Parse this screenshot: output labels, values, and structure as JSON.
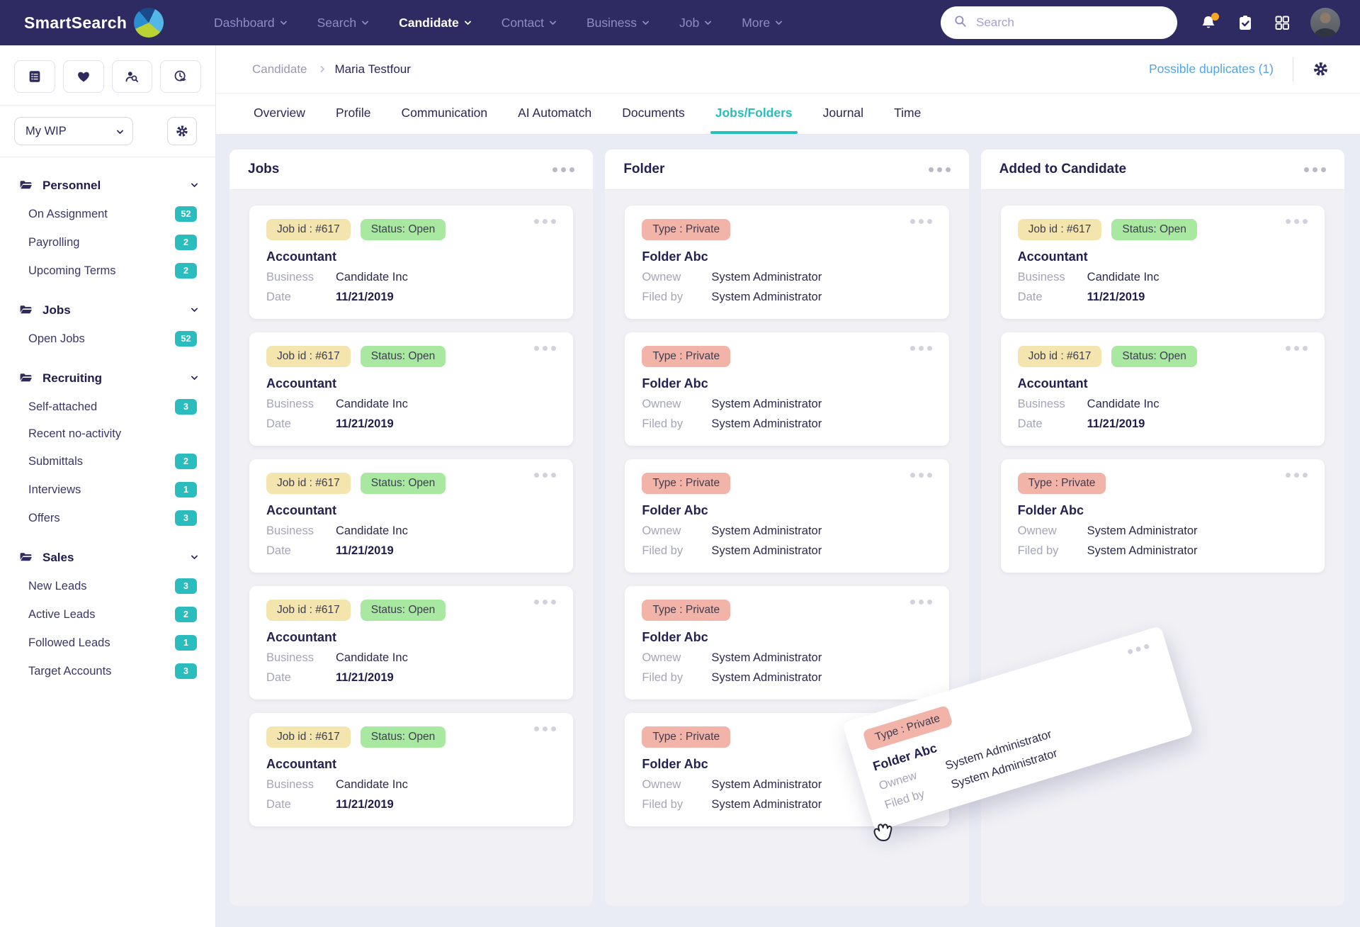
{
  "colors": {
    "navbar_bg": "#2e2a62",
    "accent_teal": "#2bbcbe",
    "link_blue": "#55a3e9",
    "badge_yellow": "#f3e5ad",
    "badge_green": "#a9e8a1",
    "badge_pink": "#f2b3a9",
    "notification_dot": "#f5a623"
  },
  "navbar": {
    "brand": "SmartSearch",
    "items": [
      {
        "label": "Dashboard"
      },
      {
        "label": "Search"
      },
      {
        "label": "Candidate",
        "active": true
      },
      {
        "label": "Contact"
      },
      {
        "label": "Business"
      },
      {
        "label": "Job"
      },
      {
        "label": "More"
      }
    ],
    "search_placeholder": "Search"
  },
  "sidebar": {
    "wip_selector": "My WIP",
    "sections": [
      {
        "label": "Personnel",
        "items": [
          {
            "label": "On Assignment",
            "count": "52"
          },
          {
            "label": "Payrolling",
            "count": "2"
          },
          {
            "label": "Upcoming Terms",
            "count": "2"
          }
        ]
      },
      {
        "label": "Jobs",
        "items": [
          {
            "label": "Open Jobs",
            "count": "52"
          }
        ]
      },
      {
        "label": "Recruiting",
        "items": [
          {
            "label": "Self-attached",
            "count": "3"
          },
          {
            "label": "Recent no-activity",
            "count": ""
          },
          {
            "label": "Submittals",
            "count": "2"
          },
          {
            "label": "Interviews",
            "count": "1"
          },
          {
            "label": "Offers",
            "count": "3"
          }
        ]
      },
      {
        "label": "Sales",
        "items": [
          {
            "label": "New Leads",
            "count": "3"
          },
          {
            "label": "Active Leads",
            "count": "2"
          },
          {
            "label": "Followed Leads",
            "count": "1"
          },
          {
            "label": "Target Accounts",
            "count": "3"
          }
        ]
      }
    ]
  },
  "header": {
    "breadcrumb_root": "Candidate",
    "breadcrumb_current": "Maria Testfour",
    "duplicates_link": "Possible duplicates (1)"
  },
  "tabs": [
    {
      "label": "Overview"
    },
    {
      "label": "Profile"
    },
    {
      "label": "Communication"
    },
    {
      "label": "AI Automatch"
    },
    {
      "label": "Documents"
    },
    {
      "label": "Jobs/Folders",
      "active": true
    },
    {
      "label": "Journal"
    },
    {
      "label": "Time"
    }
  ],
  "board": {
    "columns": [
      {
        "title": "Jobs",
        "cards": [
          {
            "badges": [
              {
                "text": "Job id : #617",
                "color": "yellow"
              },
              {
                "text": "Status: Open",
                "color": "green"
              }
            ],
            "title": "Accountant",
            "rows": [
              {
                "label": "Business",
                "value": "Candidate Inc"
              },
              {
                "label": "Date",
                "value": "11/21/2019",
                "strong": true
              }
            ]
          },
          {
            "badges": [
              {
                "text": "Job id : #617",
                "color": "yellow"
              },
              {
                "text": "Status: Open",
                "color": "green"
              }
            ],
            "title": "Accountant",
            "rows": [
              {
                "label": "Business",
                "value": "Candidate Inc"
              },
              {
                "label": "Date",
                "value": "11/21/2019",
                "strong": true
              }
            ]
          },
          {
            "badges": [
              {
                "text": "Job id : #617",
                "color": "yellow"
              },
              {
                "text": "Status: Open",
                "color": "green"
              }
            ],
            "title": "Accountant",
            "rows": [
              {
                "label": "Business",
                "value": "Candidate Inc"
              },
              {
                "label": "Date",
                "value": "11/21/2019",
                "strong": true
              }
            ]
          },
          {
            "badges": [
              {
                "text": "Job id : #617",
                "color": "yellow"
              },
              {
                "text": "Status: Open",
                "color": "green"
              }
            ],
            "title": "Accountant",
            "rows": [
              {
                "label": "Business",
                "value": "Candidate Inc"
              },
              {
                "label": "Date",
                "value": "11/21/2019",
                "strong": true
              }
            ]
          },
          {
            "badges": [
              {
                "text": "Job id : #617",
                "color": "yellow"
              },
              {
                "text": "Status: Open",
                "color": "green"
              }
            ],
            "title": "Accountant",
            "rows": [
              {
                "label": "Business",
                "value": "Candidate Inc"
              },
              {
                "label": "Date",
                "value": "11/21/2019",
                "strong": true
              }
            ]
          }
        ]
      },
      {
        "title": "Folder",
        "cards": [
          {
            "badges": [
              {
                "text": "Type : Private",
                "color": "pink"
              }
            ],
            "title": "Folder Abc",
            "rows": [
              {
                "label": "Ownew",
                "value": "System Administrator"
              },
              {
                "label": "Filed by",
                "value": "System Administrator"
              }
            ]
          },
          {
            "badges": [
              {
                "text": "Type : Private",
                "color": "pink"
              }
            ],
            "title": "Folder Abc",
            "rows": [
              {
                "label": "Ownew",
                "value": "System Administrator"
              },
              {
                "label": "Filed by",
                "value": "System Administrator"
              }
            ]
          },
          {
            "badges": [
              {
                "text": "Type : Private",
                "color": "pink"
              }
            ],
            "title": "Folder Abc",
            "rows": [
              {
                "label": "Ownew",
                "value": "System Administrator"
              },
              {
                "label": "Filed by",
                "value": "System Administrator"
              }
            ]
          },
          {
            "badges": [
              {
                "text": "Type : Private",
                "color": "pink"
              }
            ],
            "title": "Folder Abc",
            "rows": [
              {
                "label": "Ownew",
                "value": "System Administrator"
              },
              {
                "label": "Filed by",
                "value": "System Administrator"
              }
            ]
          },
          {
            "badges": [
              {
                "text": "Type : Private",
                "color": "pink"
              }
            ],
            "title": "Folder Abc",
            "rows": [
              {
                "label": "Ownew",
                "value": "System Administrator"
              },
              {
                "label": "Filed by",
                "value": "System Administrator"
              }
            ]
          }
        ]
      },
      {
        "title": "Added to Candidate",
        "cards": [
          {
            "badges": [
              {
                "text": "Job id : #617",
                "color": "yellow"
              },
              {
                "text": "Status: Open",
                "color": "green"
              }
            ],
            "title": "Accountant",
            "rows": [
              {
                "label": "Business",
                "value": "Candidate Inc"
              },
              {
                "label": "Date",
                "value": "11/21/2019",
                "strong": true
              }
            ]
          },
          {
            "badges": [
              {
                "text": "Job id : #617",
                "color": "yellow"
              },
              {
                "text": "Status: Open",
                "color": "green"
              }
            ],
            "title": "Accountant",
            "rows": [
              {
                "label": "Business",
                "value": "Candidate Inc"
              },
              {
                "label": "Date",
                "value": "11/21/2019",
                "strong": true
              }
            ]
          },
          {
            "badges": [
              {
                "text": "Type : Private",
                "color": "pink"
              }
            ],
            "title": "Folder Abc",
            "rows": [
              {
                "label": "Ownew",
                "value": "System Administrator"
              },
              {
                "label": "Filed by",
                "value": "System Administrator"
              }
            ]
          }
        ]
      }
    ],
    "drag_card": {
      "badges": [
        {
          "text": "Type : Private",
          "color": "pink"
        }
      ],
      "title": "Folder Abc",
      "rows": [
        {
          "label": "Ownew",
          "value": "System Administrator"
        },
        {
          "label": "Filed by",
          "value": "System Administrator"
        }
      ]
    }
  }
}
